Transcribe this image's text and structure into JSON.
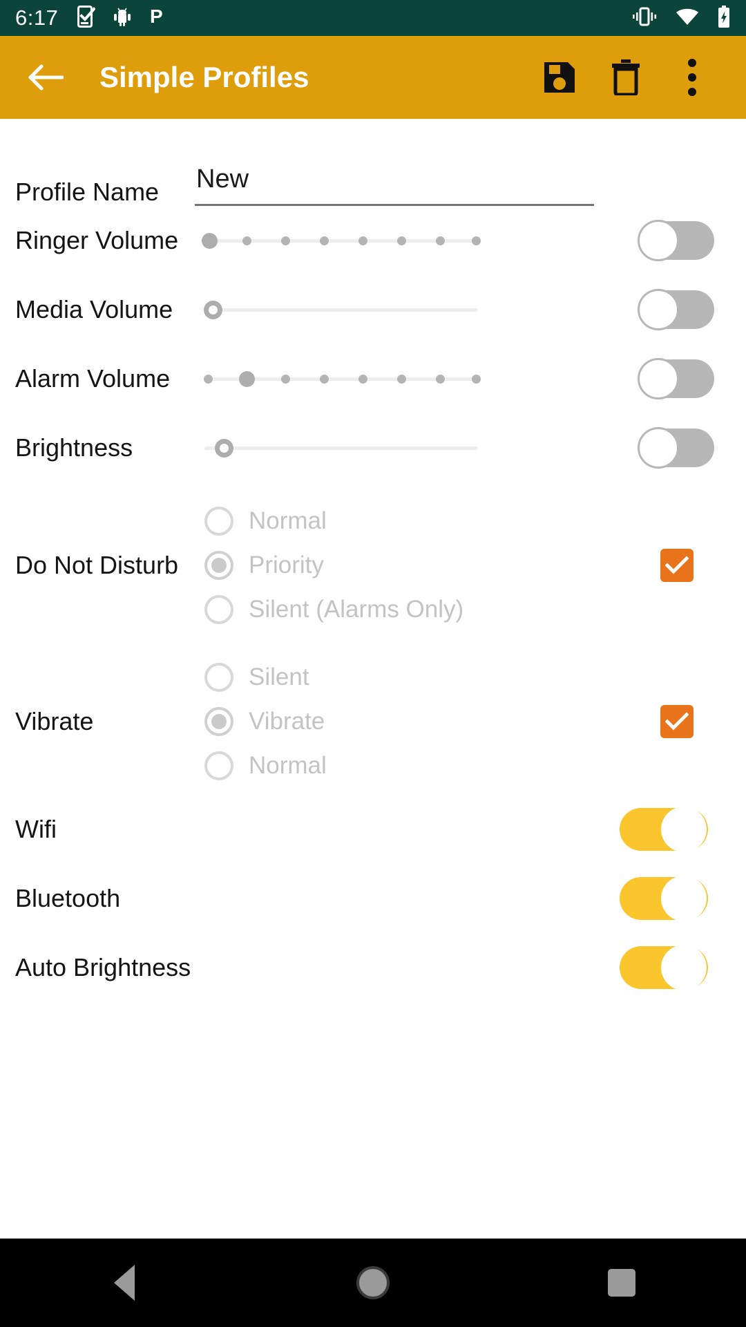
{
  "status_bar": {
    "time": "6:17",
    "background_color": "#0B4438",
    "left_icons": [
      "tasks-checklist-icon",
      "android-robot-icon",
      "p-logo-icon"
    ],
    "right_icons": [
      "vibrate-icon",
      "wifi-icon",
      "battery-charging-icon"
    ]
  },
  "app_bar": {
    "background_color": "#DE9D0B",
    "title": "Simple Profiles",
    "back_icon": "back-arrow-icon",
    "actions": [
      {
        "name": "save-icon",
        "label": "Save"
      },
      {
        "name": "delete-icon",
        "label": "Delete"
      },
      {
        "name": "overflow-menu-icon",
        "label": "More options"
      }
    ]
  },
  "form": {
    "profile_name": {
      "label": "Profile Name",
      "value": "New",
      "placeholder": "Profile Name"
    },
    "sliders": [
      {
        "label": "Ringer Volume",
        "style": "discrete",
        "ticks": 8,
        "value": 0,
        "max": 7,
        "enabled": false,
        "toggle_state": "off"
      },
      {
        "label": "Media Volume",
        "style": "continuous",
        "ticks": 0,
        "value": 0,
        "max": 100,
        "enabled": false,
        "toggle_state": "off"
      },
      {
        "label": "Alarm Volume",
        "style": "discrete",
        "ticks": 8,
        "value": 1,
        "max": 7,
        "enabled": false,
        "toggle_state": "off"
      },
      {
        "label": "Brightness",
        "style": "continuous",
        "ticks": 0,
        "value": 2,
        "max": 100,
        "enabled": false,
        "toggle_state": "off"
      }
    ],
    "radio_rows": [
      {
        "label": "Do Not Disturb",
        "enabled": false,
        "checkbox_checked": true,
        "checkbox_color": "#E8731A",
        "options": [
          {
            "label": "Normal",
            "selected": false
          },
          {
            "label": "Priority",
            "selected": true
          },
          {
            "label": "Silent (Alarms Only)",
            "selected": false
          }
        ]
      },
      {
        "label": "Vibrate",
        "enabled": false,
        "checkbox_checked": true,
        "checkbox_color": "#E8731A",
        "options": [
          {
            "label": "Silent",
            "selected": false
          },
          {
            "label": "Vibrate",
            "selected": true
          },
          {
            "label": "Normal",
            "selected": false
          }
        ]
      }
    ],
    "toggle_rows": [
      {
        "label": "Wifi",
        "state": "on"
      },
      {
        "label": "Bluetooth",
        "state": "on"
      },
      {
        "label": "Auto Brightness",
        "state": "on"
      }
    ]
  },
  "colors": {
    "accent_amber": "#DE9D0B",
    "toggle_on": "#FBC52D",
    "toggle_off": "#B7B7B7",
    "checkbox_orange": "#E8731A",
    "status_bar_green": "#0B4438"
  },
  "nav_bar": {
    "background_color": "#000000",
    "buttons": [
      "back-triangle-icon",
      "home-circle-icon",
      "recents-square-icon"
    ]
  }
}
